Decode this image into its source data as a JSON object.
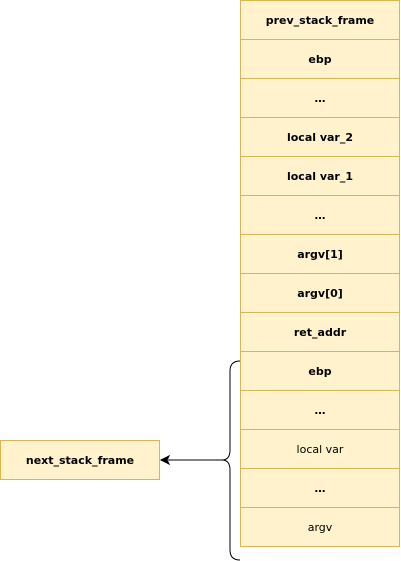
{
  "stack_frames": {
    "prev_frame_cells": [
      "prev_stack_frame",
      "ebp",
      "…",
      "local var_2",
      "local var_1",
      "…",
      "argv[1]",
      "argv[0]",
      "ret_addr"
    ],
    "next_frame_cells": [
      "ebp",
      "…",
      "local var",
      "…",
      "argv"
    ],
    "next_frame_label": "next_stack_frame"
  },
  "colors": {
    "cell_fill": "#fff2cc",
    "cell_border": "#d6b656",
    "connector": "#000000"
  }
}
